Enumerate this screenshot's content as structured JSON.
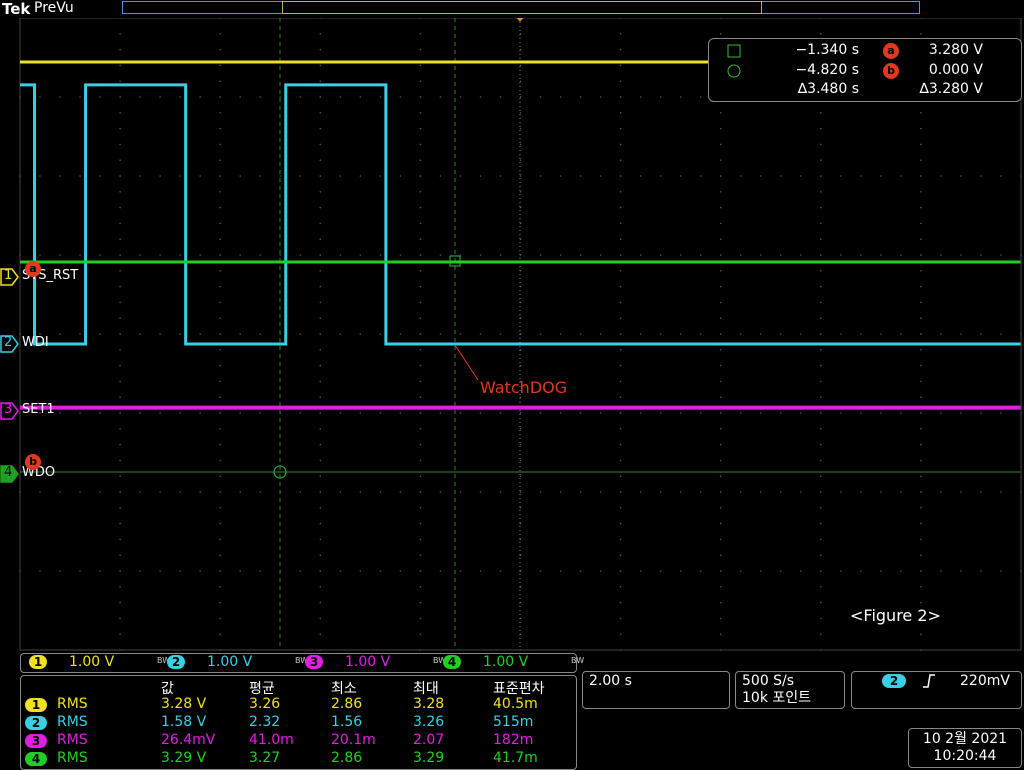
{
  "header": {
    "brand": "Tek",
    "mode": "PreVu",
    "trigger_marker": "T"
  },
  "channels": [
    {
      "num": "1",
      "name": "SYS_RST",
      "color": "#f0e020"
    },
    {
      "num": "2",
      "name": "WDI",
      "color": "#39d0e6"
    },
    {
      "num": "3",
      "name": "SET1",
      "color": "#e020e0"
    },
    {
      "num": "4",
      "name": "WDO",
      "color": "#20d020"
    }
  ],
  "cursor_readout": {
    "t1": "−1.340 s",
    "v1": "3.280 V",
    "t2": "−4.820 s",
    "v2": "0.000 V",
    "dt": "∆3.480 s",
    "dv": "∆3.280 V",
    "marker_a": "a",
    "marker_b": "b"
  },
  "annotation": "WatchDOG",
  "figure_label": "<Figure 2>",
  "vertical_scale": [
    {
      "num": "1",
      "value": "1.00 V",
      "bw": "BW"
    },
    {
      "num": "2",
      "value": "1.00 V",
      "bw": "BW"
    },
    {
      "num": "3",
      "value": "1.00 V",
      "bw": "BW"
    },
    {
      "num": "4",
      "value": "1.00 V",
      "bw": "BW"
    }
  ],
  "measurements": {
    "headers": [
      "값",
      "평균",
      "최소",
      "최대",
      "표준편차"
    ],
    "rows": [
      {
        "num": "1",
        "type": "RMS",
        "value": "3.28 V",
        "mean": "3.26",
        "min": "2.86",
        "max": "3.28",
        "std": "40.5m"
      },
      {
        "num": "2",
        "type": "RMS",
        "value": "1.58 V",
        "mean": "2.32",
        "min": "1.56",
        "max": "3.26",
        "std": "515m"
      },
      {
        "num": "3",
        "type": "RMS",
        "value": "26.4mV",
        "mean": "41.0m",
        "min": "20.1m",
        "max": "2.07",
        "std": "182m"
      },
      {
        "num": "4",
        "type": "RMS",
        "value": "3.29 V",
        "mean": "3.27",
        "min": "2.86",
        "max": "3.29",
        "std": "41.7m"
      }
    ]
  },
  "horizontal": {
    "time_per_div": "2.00 s",
    "sample_rate": "500 S/s",
    "record_length": "10k 포인트"
  },
  "trigger": {
    "source": "2",
    "slope_icon": "rising-edge",
    "level": "220mV"
  },
  "datetime": {
    "date": "10 2월 2021",
    "time": "10:20:44"
  },
  "chart_data": {
    "type": "line",
    "xlabel": "",
    "ylabel": "",
    "time_per_div_s": 2.0,
    "series": [
      {
        "name": "SYS_RST",
        "x": [
          -10,
          10
        ],
        "y": [
          3.28,
          3.28
        ]
      },
      {
        "name": "WDI",
        "x": [
          -10,
          -9.7,
          -9.7,
          -8.68,
          -8.68,
          -6.68,
          -6.68,
          -4.68,
          -4.68,
          -2.68,
          -2.68,
          -2.68,
          10
        ],
        "y": [
          3.28,
          3.28,
          0,
          0,
          3.28,
          3.28,
          0,
          0,
          3.28,
          3.28,
          0,
          0,
          0
        ]
      },
      {
        "name": "SET1",
        "x": [
          -10,
          10
        ],
        "y": [
          0.03,
          0.03
        ]
      },
      {
        "name": "WDO",
        "x": [
          -10,
          10
        ],
        "y": [
          3.28,
          3.28
        ]
      }
    ]
  }
}
